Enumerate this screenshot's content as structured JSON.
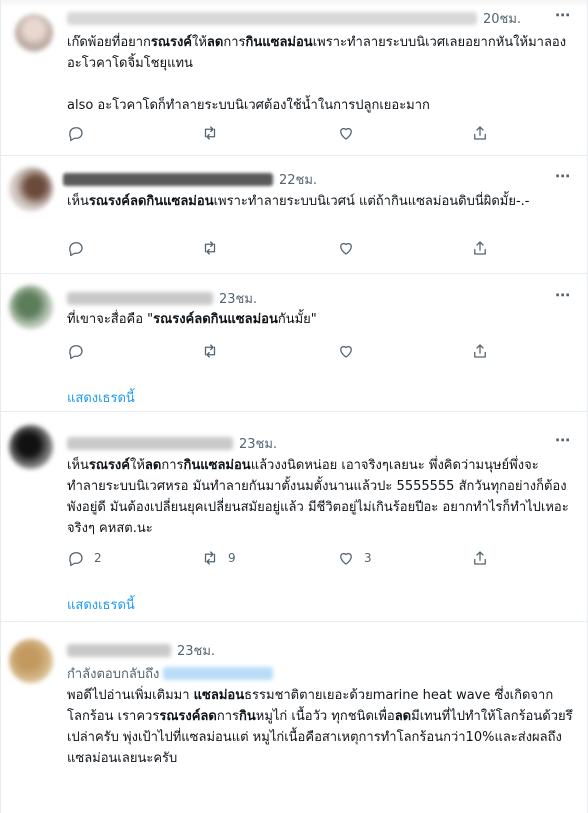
{
  "tweets": [
    {
      "time": "20ชม.",
      "text_parts": [
        {
          "t": "เก๊ดพ้อยที่อยาก",
          "b": false
        },
        {
          "t": "รณรงค์",
          "b": true
        },
        {
          "t": "ให้",
          "b": false
        },
        {
          "t": "ลด",
          "b": true
        },
        {
          "t": "การ",
          "b": false
        },
        {
          "t": "กินแซลม่อน",
          "b": true
        },
        {
          "t": "เพราะทำลายระบบนิเวศเลยอยากหันให้มาลองอะโวคาโดจิ้มโชยุแทน\n\nalso อะโวคาโดก็ทำลายระบบนิเวศต้องใช้น้ำในการปลูกเยอะมาก",
          "b": false
        }
      ],
      "reply_count": "",
      "retweet_count": "",
      "like_count": ""
    },
    {
      "time": "22ชม.",
      "text_parts": [
        {
          "t": "เห็น",
          "b": false
        },
        {
          "t": "รณรงค์ลดกินแซลม่อน",
          "b": true
        },
        {
          "t": "เพราะทำลายระบบนิเวศน์ แต่ถ้ากินแซลม่อนดิบนี่ผิดมั้ย-.-",
          "b": false
        }
      ],
      "reply_count": "",
      "retweet_count": "",
      "like_count": ""
    },
    {
      "time": "23ชม.",
      "text_parts": [
        {
          "t": "ที่เขาจะสื่อคือ \"",
          "b": false
        },
        {
          "t": "รณรงค์ลดกินแซลม่อน",
          "b": true
        },
        {
          "t": "กันมั้ย\"",
          "b": false
        }
      ],
      "reply_count": "",
      "retweet_count": "",
      "like_count": "",
      "show_thread": "แสดงเธรดนี้"
    },
    {
      "time": "23ชม.",
      "text_parts": [
        {
          "t": "เห็น",
          "b": false
        },
        {
          "t": "รณรงค์",
          "b": true
        },
        {
          "t": "ให้",
          "b": false
        },
        {
          "t": "ลด",
          "b": true
        },
        {
          "t": "การ",
          "b": false
        },
        {
          "t": "กินแซลม่อน",
          "b": true
        },
        {
          "t": "แล้วงงนิดหน่อย เอาจริงๆเลยนะ พึ่งคิดว่ามนุษย์พึ่งจะทำลายระบบนิเวศหรอ มันทำลายกันมาตั้งนมตั้งนานแล้วปะ 5555555 สักวันทุกอย่างก็ต้องพังอยู่ดี มันต้องเปลี่ยนยุคเปลี่ยนสมัยอยู่แล้ว มีชีวิตอยู่ไม่เกินร้อยปีอะ อยากทำไรก็ทำไปเหอะจริงๆ คหสต.นะ",
          "b": false
        }
      ],
      "reply_count": "2",
      "retweet_count": "9",
      "like_count": "3",
      "show_thread": "แสดงเธรดนี้"
    },
    {
      "time": "23ชม.",
      "reply_label": "กำลังตอบกลับถึง",
      "text_parts": [
        {
          "t": "พอดีไปอ่านเพิ่มเติมมา ",
          "b": false
        },
        {
          "t": "แซลม่อน",
          "b": true
        },
        {
          "t": "ธรรมชาติตายเยอะด้วยmarine heat wave ซึ่งเกิดจากโลกร้อน เราควร",
          "b": false
        },
        {
          "t": "รณรงค์ลด",
          "b": true
        },
        {
          "t": "การ",
          "b": false
        },
        {
          "t": "กิน",
          "b": true
        },
        {
          "t": "หมูไก่ เนื้อวัว ทุกชนิดเพื่อ",
          "b": false
        },
        {
          "t": "ลด",
          "b": true
        },
        {
          "t": "มีเทนที่ไปทำให้โลกร้อนด้วยรึเปล่าครับ พุ่งเป้าไปที่แซลม่อนแต่ หมูไก่เนื้อคือสาเหตุการทำโลกร้อนกว่า10%และส่งผลถึงแซลม่อนเลยนะครับ",
          "b": false
        }
      ]
    }
  ]
}
